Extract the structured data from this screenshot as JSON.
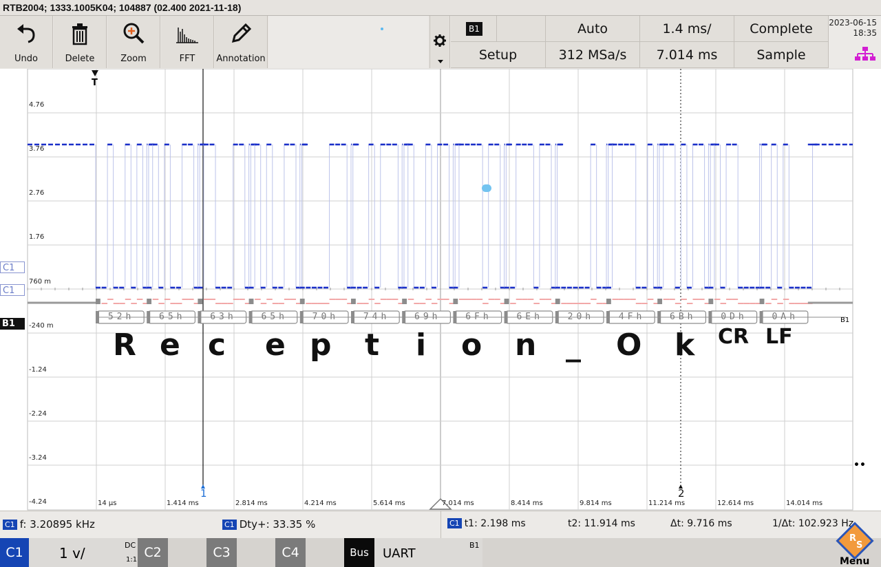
{
  "title": "RTB2004; 1333.1005K04; 104887 (02.400 2021-11-18)",
  "toolbar": {
    "undo": "Undo",
    "delete": "Delete",
    "zoom": "Zoom",
    "fft": "FFT",
    "annotation": "Annotation"
  },
  "status": {
    "bus_badge": "B1",
    "setup": "Setup",
    "trigger_mode": "Auto",
    "sample_rate": "312 MSa/s",
    "timebase": "1.4 ms/",
    "trigger_pos": "7.014 ms",
    "acq_state": "Complete",
    "acq_mode": "Sample",
    "date": "2023-06-15",
    "time": "18:35"
  },
  "plot": {
    "trigger_marker": "T",
    "y_labels": [
      "4.76",
      "3.76",
      "2.76",
      "1.76",
      "760 m",
      "-240 m",
      "-1.24",
      "-2.24",
      "-3.24",
      "-4.24"
    ],
    "x_labels": [
      "14 µs",
      "1.414 ms",
      "2.814 ms",
      "4.214 ms",
      "5.614 ms",
      "7.014 ms",
      "8.414 ms",
      "9.814 ms",
      "11.214 ms",
      "12.614 ms",
      "14.014 ms"
    ],
    "channel_marker_trigger": "C1",
    "channel_marker_offset": "C1",
    "bus_marker": "B1",
    "bus_end_label": "B1",
    "cursor1_label": "1",
    "cursor2_label": "2",
    "decode_bytes": [
      "52h",
      "65h",
      "63h",
      "65h",
      "70h",
      "74h",
      "69h",
      "6Fh",
      "6Eh",
      "20h",
      "4Fh",
      "6Bh",
      "0Dh",
      "0Ah"
    ],
    "annotation_text": [
      "R",
      "e",
      "c",
      "e",
      "p",
      "t",
      "i",
      "o",
      "n",
      "_",
      "O",
      "k",
      "CR",
      "LF"
    ]
  },
  "measurements": {
    "ch": "C1",
    "freq": "f: 3.20895 kHz",
    "duty": "Dty+: 33.35 %",
    "t1": "t1: 2.198 ms",
    "t2": "t2: 11.914 ms",
    "dt": "Δt: 9.716 ms",
    "inv_dt": "1/Δt: 102.923 Hz"
  },
  "channels": {
    "c1": "C1",
    "c1_scale": "1 v/",
    "c1_coupling": "DC",
    "c1_probe": "1:1",
    "c2": "C2",
    "c3": "C3",
    "c4": "C4",
    "bus": "Bus",
    "bus_protocol": "UART",
    "bus_id": "B1",
    "menu": "Menu"
  },
  "colors": {
    "trace": "#1a2fc9",
    "decode_high": "#f2a8a8",
    "bus_active": "#0a0a0a",
    "channel_blue": "#1545b4",
    "grid": "#c8c8c8"
  }
}
